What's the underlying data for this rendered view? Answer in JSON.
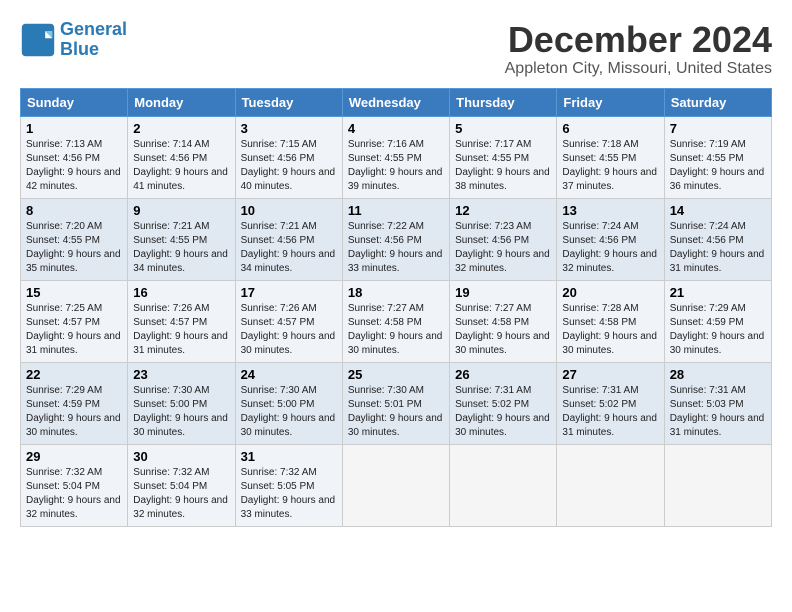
{
  "header": {
    "logo_line1": "General",
    "logo_line2": "Blue",
    "month": "December 2024",
    "location": "Appleton City, Missouri, United States"
  },
  "weekdays": [
    "Sunday",
    "Monday",
    "Tuesday",
    "Wednesday",
    "Thursday",
    "Friday",
    "Saturday"
  ],
  "weeks": [
    [
      {
        "day": "1",
        "sunrise": "7:13 AM",
        "sunset": "4:56 PM",
        "daylight": "9 hours and 42 minutes."
      },
      {
        "day": "2",
        "sunrise": "7:14 AM",
        "sunset": "4:56 PM",
        "daylight": "9 hours and 41 minutes."
      },
      {
        "day": "3",
        "sunrise": "7:15 AM",
        "sunset": "4:56 PM",
        "daylight": "9 hours and 40 minutes."
      },
      {
        "day": "4",
        "sunrise": "7:16 AM",
        "sunset": "4:55 PM",
        "daylight": "9 hours and 39 minutes."
      },
      {
        "day": "5",
        "sunrise": "7:17 AM",
        "sunset": "4:55 PM",
        "daylight": "9 hours and 38 minutes."
      },
      {
        "day": "6",
        "sunrise": "7:18 AM",
        "sunset": "4:55 PM",
        "daylight": "9 hours and 37 minutes."
      },
      {
        "day": "7",
        "sunrise": "7:19 AM",
        "sunset": "4:55 PM",
        "daylight": "9 hours and 36 minutes."
      }
    ],
    [
      {
        "day": "8",
        "sunrise": "7:20 AM",
        "sunset": "4:55 PM",
        "daylight": "9 hours and 35 minutes."
      },
      {
        "day": "9",
        "sunrise": "7:21 AM",
        "sunset": "4:55 PM",
        "daylight": "9 hours and 34 minutes."
      },
      {
        "day": "10",
        "sunrise": "7:21 AM",
        "sunset": "4:56 PM",
        "daylight": "9 hours and 34 minutes."
      },
      {
        "day": "11",
        "sunrise": "7:22 AM",
        "sunset": "4:56 PM",
        "daylight": "9 hours and 33 minutes."
      },
      {
        "day": "12",
        "sunrise": "7:23 AM",
        "sunset": "4:56 PM",
        "daylight": "9 hours and 32 minutes."
      },
      {
        "day": "13",
        "sunrise": "7:24 AM",
        "sunset": "4:56 PM",
        "daylight": "9 hours and 32 minutes."
      },
      {
        "day": "14",
        "sunrise": "7:24 AM",
        "sunset": "4:56 PM",
        "daylight": "9 hours and 31 minutes."
      }
    ],
    [
      {
        "day": "15",
        "sunrise": "7:25 AM",
        "sunset": "4:57 PM",
        "daylight": "9 hours and 31 minutes."
      },
      {
        "day": "16",
        "sunrise": "7:26 AM",
        "sunset": "4:57 PM",
        "daylight": "9 hours and 31 minutes."
      },
      {
        "day": "17",
        "sunrise": "7:26 AM",
        "sunset": "4:57 PM",
        "daylight": "9 hours and 30 minutes."
      },
      {
        "day": "18",
        "sunrise": "7:27 AM",
        "sunset": "4:58 PM",
        "daylight": "9 hours and 30 minutes."
      },
      {
        "day": "19",
        "sunrise": "7:27 AM",
        "sunset": "4:58 PM",
        "daylight": "9 hours and 30 minutes."
      },
      {
        "day": "20",
        "sunrise": "7:28 AM",
        "sunset": "4:58 PM",
        "daylight": "9 hours and 30 minutes."
      },
      {
        "day": "21",
        "sunrise": "7:29 AM",
        "sunset": "4:59 PM",
        "daylight": "9 hours and 30 minutes."
      }
    ],
    [
      {
        "day": "22",
        "sunrise": "7:29 AM",
        "sunset": "4:59 PM",
        "daylight": "9 hours and 30 minutes."
      },
      {
        "day": "23",
        "sunrise": "7:30 AM",
        "sunset": "5:00 PM",
        "daylight": "9 hours and 30 minutes."
      },
      {
        "day": "24",
        "sunrise": "7:30 AM",
        "sunset": "5:00 PM",
        "daylight": "9 hours and 30 minutes."
      },
      {
        "day": "25",
        "sunrise": "7:30 AM",
        "sunset": "5:01 PM",
        "daylight": "9 hours and 30 minutes."
      },
      {
        "day": "26",
        "sunrise": "7:31 AM",
        "sunset": "5:02 PM",
        "daylight": "9 hours and 30 minutes."
      },
      {
        "day": "27",
        "sunrise": "7:31 AM",
        "sunset": "5:02 PM",
        "daylight": "9 hours and 31 minutes."
      },
      {
        "day": "28",
        "sunrise": "7:31 AM",
        "sunset": "5:03 PM",
        "daylight": "9 hours and 31 minutes."
      }
    ],
    [
      {
        "day": "29",
        "sunrise": "7:32 AM",
        "sunset": "5:04 PM",
        "daylight": "9 hours and 32 minutes."
      },
      {
        "day": "30",
        "sunrise": "7:32 AM",
        "sunset": "5:04 PM",
        "daylight": "9 hours and 32 minutes."
      },
      {
        "day": "31",
        "sunrise": "7:32 AM",
        "sunset": "5:05 PM",
        "daylight": "9 hours and 33 minutes."
      },
      null,
      null,
      null,
      null
    ]
  ]
}
